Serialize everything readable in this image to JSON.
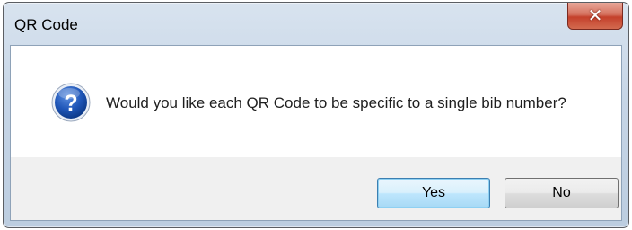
{
  "dialog": {
    "title": "QR Code",
    "close_symbol": "✕",
    "message": "Would you like each QR Code to be specific to a single bib number?",
    "icon": "question-icon",
    "buttons": {
      "yes_label": "Yes",
      "no_label": "No"
    },
    "default_button": "Yes"
  }
}
